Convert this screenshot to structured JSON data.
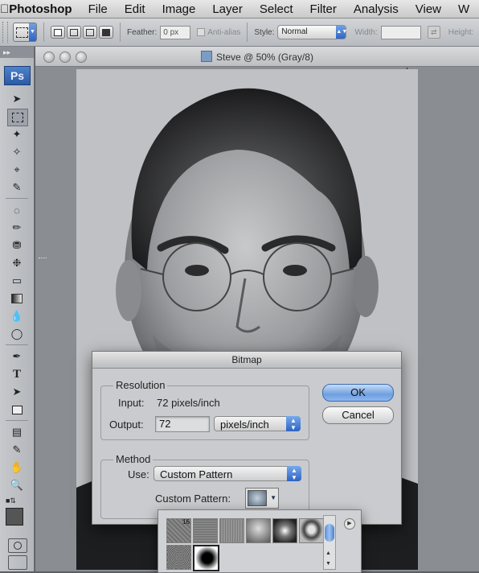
{
  "menubar": {
    "apple_icon": "apple-icon",
    "app_name": "Photoshop",
    "items": [
      "File",
      "Edit",
      "Image",
      "Layer",
      "Select",
      "Filter",
      "Analysis",
      "View",
      "W"
    ]
  },
  "options_bar": {
    "feather_label": "Feather:",
    "feather_value": "0 px",
    "antialias_label": "Anti-alias",
    "style_label": "Style:",
    "style_value": "Normal",
    "width_label": "Width:",
    "height_label": "Height:"
  },
  "toolbox": {
    "logo": "Ps"
  },
  "document": {
    "title": "Steve @ 50% (Gray/8)"
  },
  "dialog": {
    "title": "Bitmap",
    "resolution_label": "Resolution",
    "input_label": "Input:",
    "input_value": "72 pixels/inch",
    "output_label": "Output:",
    "output_value": "72",
    "output_unit": "pixels/inch",
    "method_label": "Method",
    "use_label": "Use:",
    "use_value": "Custom Pattern",
    "custom_pattern_label": "Custom Pattern:",
    "ok_label": "OK",
    "cancel_label": "Cancel"
  },
  "pattern_picker": {
    "badge": "16"
  }
}
